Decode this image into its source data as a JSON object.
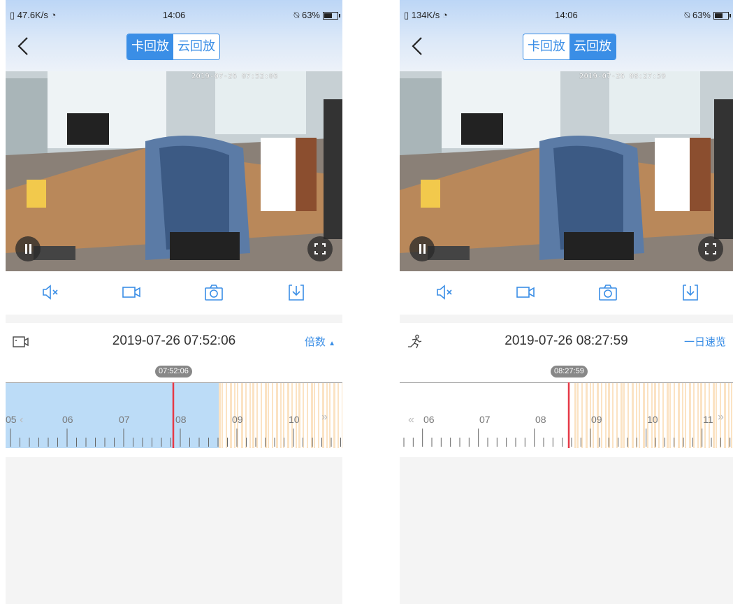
{
  "left": {
    "status": {
      "net": "47.6K/s",
      "time": "14:06",
      "battery": "63%"
    },
    "tabs": {
      "active": "卡回放",
      "inactive": "云回放"
    },
    "video": {
      "timestamp": "2019-07-26 07:52:06"
    },
    "info": {
      "datetime": "2019-07-26 07:52:06",
      "right_action": "倍数"
    },
    "timeline": {
      "cursor_label": "07:52:06",
      "hour_labels": [
        "05",
        "06",
        "07",
        "08",
        "09",
        "10"
      ],
      "mode": "card"
    }
  },
  "right": {
    "status": {
      "net": "134K/s",
      "time": "14:06",
      "battery": "63%"
    },
    "tabs": {
      "active": "云回放",
      "inactive": "卡回放"
    },
    "video": {
      "timestamp": "2019-07-26 08:27:59"
    },
    "info": {
      "datetime": "2019-07-26 08:27:59",
      "right_action": "一日速览"
    },
    "timeline": {
      "cursor_label": "08:27:59",
      "hour_labels": [
        "06",
        "07",
        "08",
        "09",
        "10",
        "11"
      ],
      "mode": "cloud"
    }
  },
  "colors": {
    "accent": "#3a8ee6",
    "cursor": "#e63946",
    "recorded_blue": "#bcdcf7",
    "event_orange": "#fbe3c4"
  },
  "icons": [
    "back-icon",
    "pause-icon",
    "fullscreen-icon",
    "mute-icon",
    "record-icon",
    "camera-icon",
    "download-icon",
    "video-mode-icon",
    "motion-icon",
    "chevron-left-double-icon",
    "chevron-right-double-icon",
    "signal-icon",
    "wifi-icon",
    "alarm-icon",
    "battery-icon"
  ]
}
